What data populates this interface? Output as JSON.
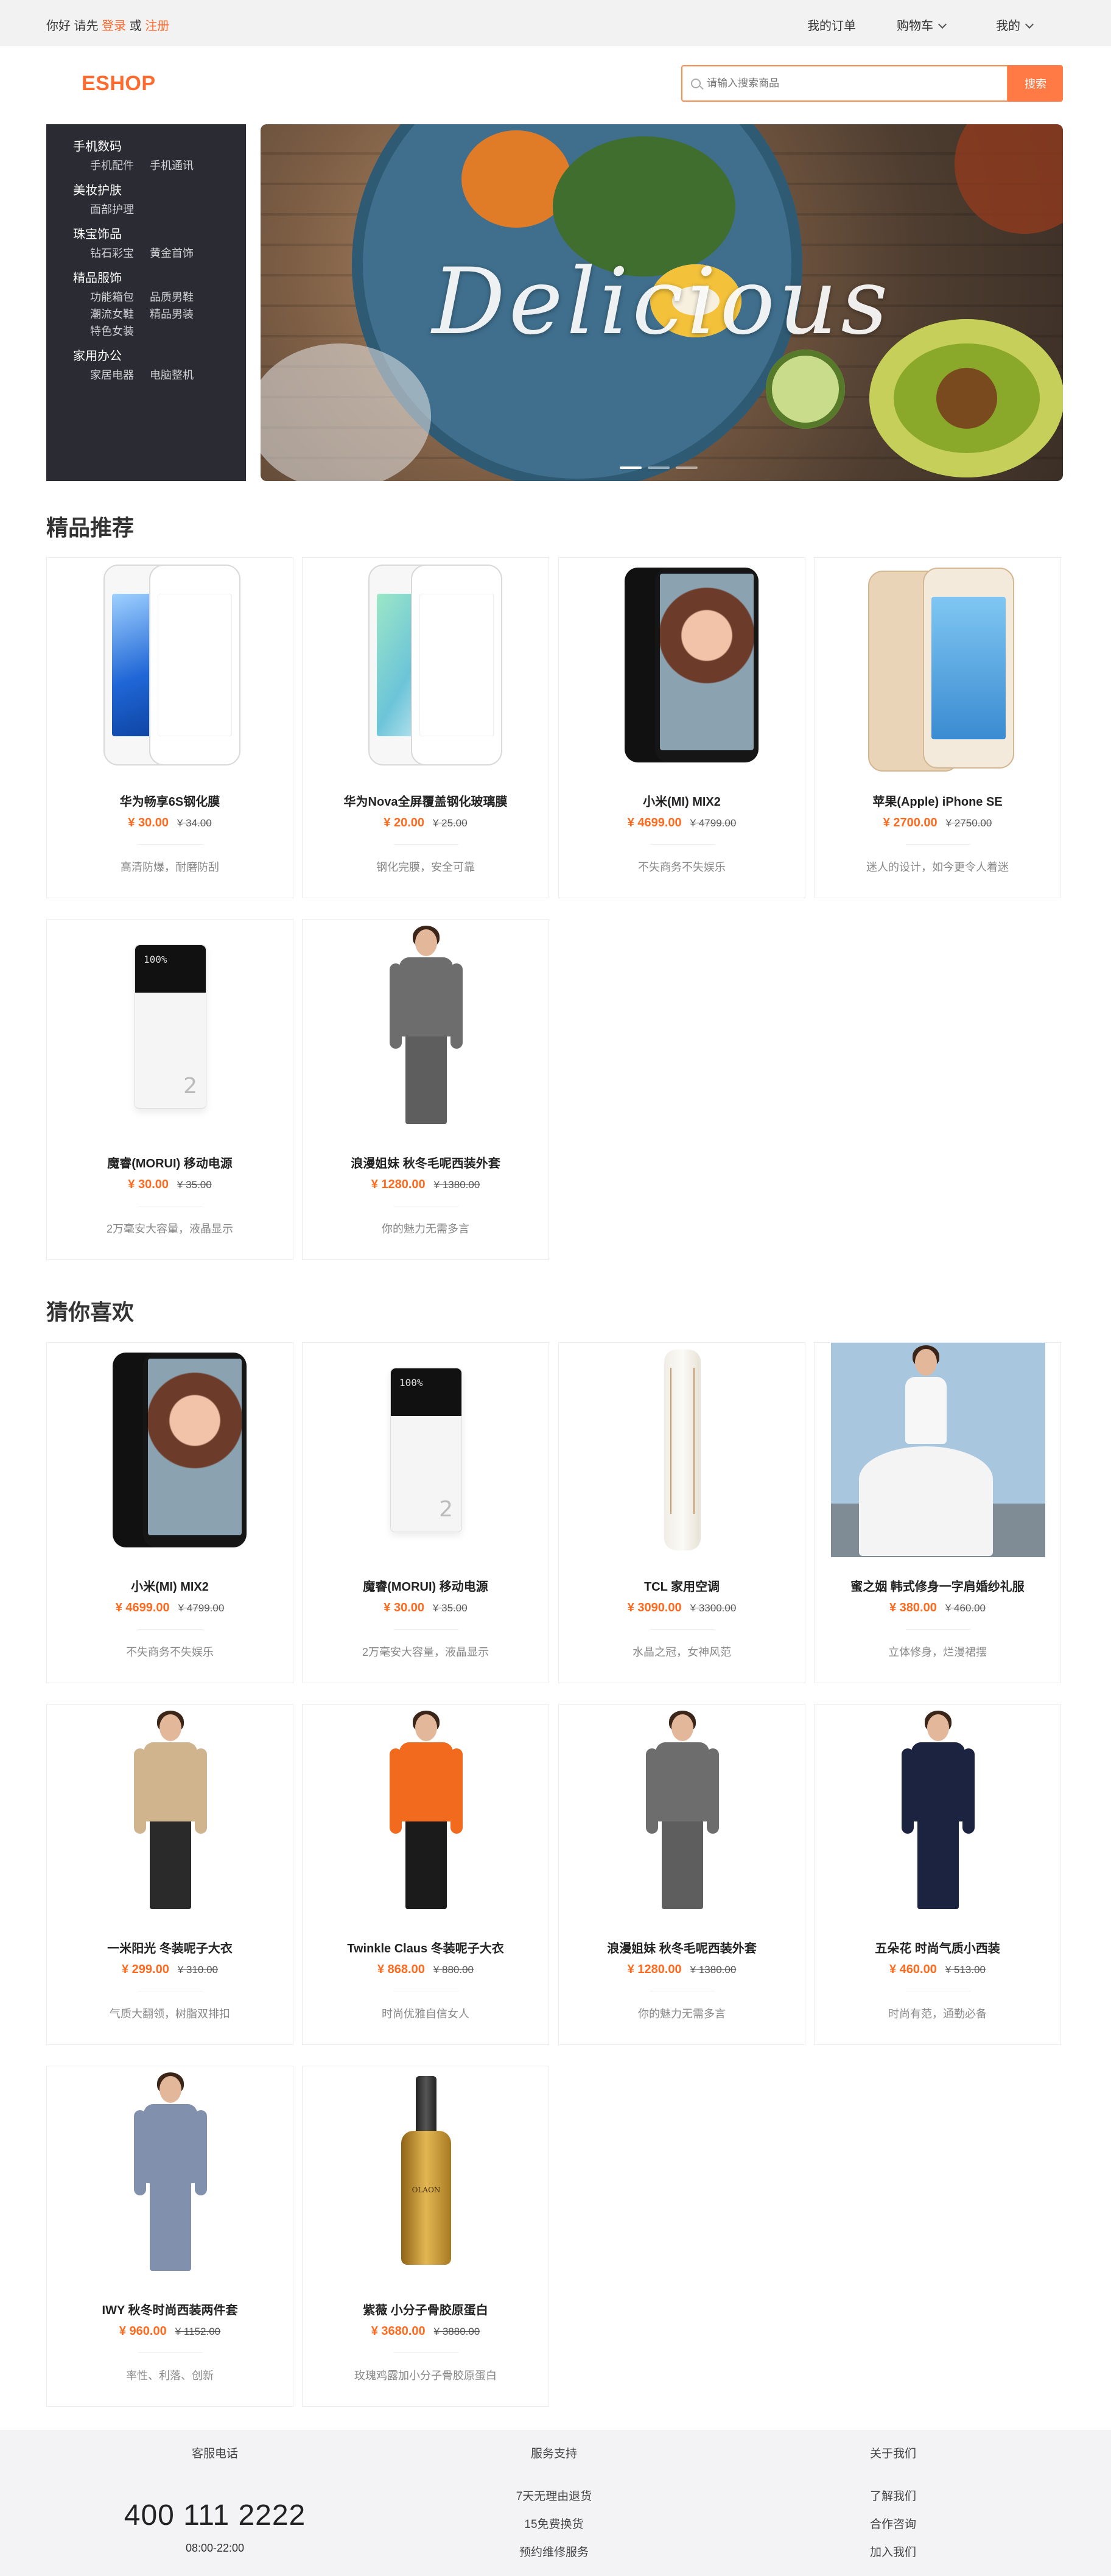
{
  "topbar": {
    "greeting": "你好 请先",
    "login": "登录",
    "or": "或",
    "register": "注册",
    "orders": "我的订单",
    "cart": "购物车",
    "mine": "我的"
  },
  "header": {
    "logo": "ESHOP",
    "search_placeholder": "请输入搜索商品",
    "search_button": "搜索"
  },
  "categories": [
    {
      "title": "手机数码",
      "subs": [
        "手机配件",
        "手机通讯"
      ]
    },
    {
      "title": "美妆护肤",
      "subs": [
        "面部护理"
      ]
    },
    {
      "title": "珠宝饰品",
      "subs": [
        "钻石彩宝",
        "黄金首饰"
      ]
    },
    {
      "title": "精品服饰",
      "subs": [
        "功能箱包",
        "品质男鞋",
        "潮流女鞋",
        "精品男装",
        "特色女装"
      ]
    },
    {
      "title": "家用办公",
      "subs": [
        "家居电器",
        "电脑整机"
      ]
    }
  ],
  "banner": {
    "text": "Delicious",
    "slides": 3,
    "active_slide": 1
  },
  "sections": {
    "featured_title": "精品推荐",
    "guess_title": "猜你喜欢"
  },
  "featured": [
    {
      "name": "华为畅享6S钢化膜",
      "price": "¥ 30.00",
      "old": "¥ 34.00",
      "desc": "高清防爆，耐磨防刮",
      "icon": "white-huawei-phone-icon"
    },
    {
      "name": "华为Nova全屏覆盖钢化玻璃膜",
      "price": "¥ 20.00",
      "old": "¥ 25.00",
      "desc": "钢化完膜，安全可靠",
      "icon": "white-nova-phone-icon"
    },
    {
      "name": "小米(MI) MIX2",
      "price": "¥ 4699.00",
      "old": "¥ 4799.00",
      "desc": "不失商务不失娱乐",
      "icon": "black-mix2-phone-icon"
    },
    {
      "name": "苹果(Apple) iPhone SE",
      "price": "¥ 2700.00",
      "old": "¥ 2750.00",
      "desc": "迷人的设计，如今更令人着迷",
      "icon": "iphone-se-icon"
    },
    {
      "name": "魔睿(MORUI) 移动电源",
      "price": "¥ 30.00",
      "old": "¥ 35.00",
      "desc": "2万毫安大容量，液晶显示",
      "icon": "power-bank-icon"
    },
    {
      "name": "浪漫姐妹 秋冬毛呢西装外套",
      "price": "¥ 1280.00",
      "old": "¥ 1380.00",
      "desc": "你的魅力无需多言",
      "icon": "grey-suit-woman-icon"
    }
  ],
  "guess": [
    {
      "name": "小米(MI) MIX2",
      "price": "¥ 4699.00",
      "old": "¥ 4799.00",
      "desc": "不失商务不失娱乐",
      "icon": "black-mix2-phone-icon"
    },
    {
      "name": "魔睿(MORUI) 移动电源",
      "price": "¥ 30.00",
      "old": "¥ 35.00",
      "desc": "2万毫安大容量，液晶显示",
      "icon": "power-bank-icon"
    },
    {
      "name": "TCL 家用空调",
      "price": "¥ 3090.00",
      "old": "¥ 3300.00",
      "desc": "水晶之冠，女神风范",
      "icon": "air-conditioner-icon"
    },
    {
      "name": "蜜之姻 韩式修身一字肩婚纱礼服",
      "price": "¥ 380.00",
      "old": "¥ 460.00",
      "desc": "立体修身，烂漫裙摆",
      "icon": "wedding-dress-icon"
    },
    {
      "name": "一米阳光 冬装呢子大衣",
      "price": "¥ 299.00",
      "old": "¥ 310.00",
      "desc": "气质大翻领，树脂双排扣",
      "icon": "beige-coat-woman-icon"
    },
    {
      "name": "Twinkle Claus 冬装呢子大衣",
      "price": "¥ 868.00",
      "old": "¥ 880.00",
      "desc": "时尚优雅自信女人",
      "icon": "orange-coat-woman-icon"
    },
    {
      "name": "浪漫姐妹 秋冬毛呢西装外套",
      "price": "¥ 1280.00",
      "old": "¥ 1380.00",
      "desc": "你的魅力无需多言",
      "icon": "grey-suit-woman-icon"
    },
    {
      "name": "五朵花 时尚气质小西装",
      "price": "¥ 460.00",
      "old": "¥ 513.00",
      "desc": "时尚有范，通勤必备",
      "icon": "navy-suit-woman-icon"
    },
    {
      "name": "IWY 秋冬时尚西装两件套",
      "price": "¥ 960.00",
      "old": "¥ 1152.00",
      "desc": "率性、利落、创新",
      "icon": "blue-suit-woman-icon"
    },
    {
      "name": "紫薇 小分子骨胶原蛋白",
      "price": "¥ 3680.00",
      "old": "¥ 3880.00",
      "desc": "玫瑰鸡露加小分子骨胶原蛋白",
      "icon": "serum-bottle-icon"
    }
  ],
  "footer": {
    "service_phone_title": "客服电话",
    "phone": "400 111 2222",
    "hours": "08:00-22:00",
    "support_title": "服务支持",
    "support_links": [
      "7天无理由退货",
      "15免费换货",
      "预约维修服务"
    ],
    "about_title": "关于我们",
    "about_links": [
      "了解我们",
      "合作咨询",
      "加入我们"
    ],
    "accent_color": "#ff6a2e"
  }
}
